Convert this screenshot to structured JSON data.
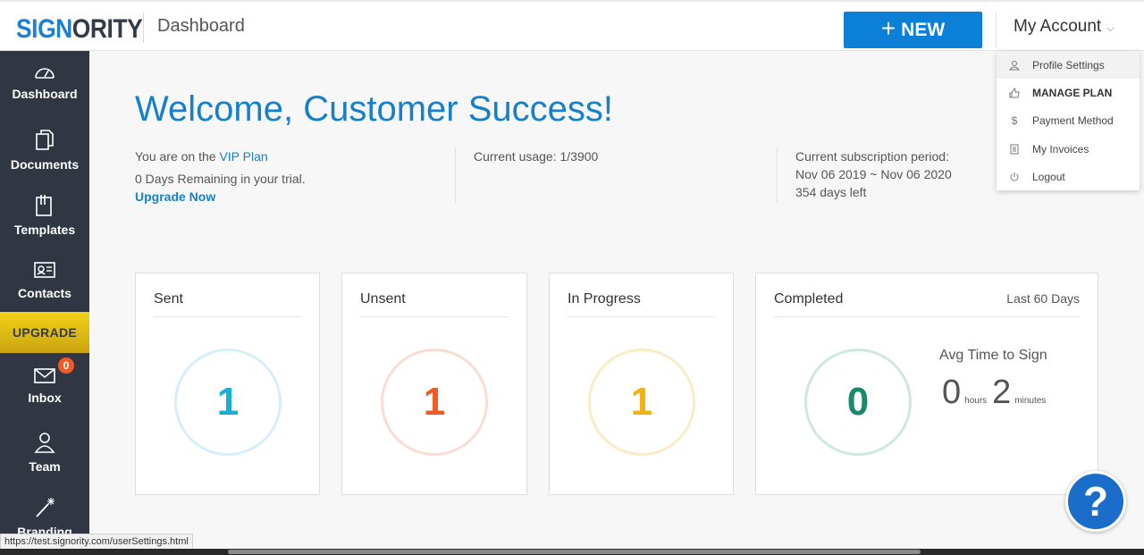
{
  "header": {
    "logo_part1": "SIGN",
    "logo_part2": "ORITY",
    "page_title": "Dashboard",
    "new_button": "NEW",
    "account_label": "My Account"
  },
  "sidebar": {
    "items": [
      {
        "label": "Dashboard",
        "icon": "gauge-icon"
      },
      {
        "label": "Documents",
        "icon": "documents-icon"
      },
      {
        "label": "Templates",
        "icon": "templates-icon"
      },
      {
        "label": "Contacts",
        "icon": "contact-card-icon"
      },
      {
        "label": "Inbox",
        "icon": "envelope-icon"
      },
      {
        "label": "Team",
        "icon": "user-icon"
      },
      {
        "label": "Branding",
        "icon": "magic-wand-icon"
      }
    ],
    "upgrade_label": "UPGRADE",
    "inbox_badge": "0"
  },
  "main": {
    "welcome": "Welcome, Customer Success!",
    "plan_prefix": "You are on the ",
    "plan_name": "VIP Plan",
    "trial_text": "0 Days Remaining in your trial.",
    "upgrade_link": "Upgrade Now",
    "usage": "Current usage: 1/3900",
    "subscription_label": "Current subscription period:",
    "subscription_range": "Nov 06 2019 ~ Nov 06 2020",
    "days_left": "354 days left"
  },
  "cards": {
    "sent": {
      "title": "Sent",
      "value": "1",
      "color": "#1aaed6"
    },
    "unsent": {
      "title": "Unsent",
      "value": "1",
      "color": "#f15a24"
    },
    "in_progress": {
      "title": "In Progress",
      "value": "1",
      "color": "#f5b014"
    },
    "completed": {
      "title": "Completed",
      "range": "Last 60 Days",
      "value": "0",
      "color": "#1a8a6e",
      "avg_title": "Avg Time to Sign",
      "hours": "0",
      "hours_unit": "hours",
      "minutes": "2",
      "minutes_unit": "minutes"
    }
  },
  "account_menu": {
    "items": [
      {
        "label": "Profile Settings",
        "icon": "user-icon"
      },
      {
        "label": "MANAGE PLAN",
        "icon": "thumbs-up-icon"
      },
      {
        "label": "Payment Method",
        "icon": "dollar-icon"
      },
      {
        "label": "My Invoices",
        "icon": "invoice-icon"
      },
      {
        "label": "Logout",
        "icon": "power-icon"
      }
    ]
  },
  "help_label": "?",
  "status_url": "https://test.signority.com/userSettings.html"
}
